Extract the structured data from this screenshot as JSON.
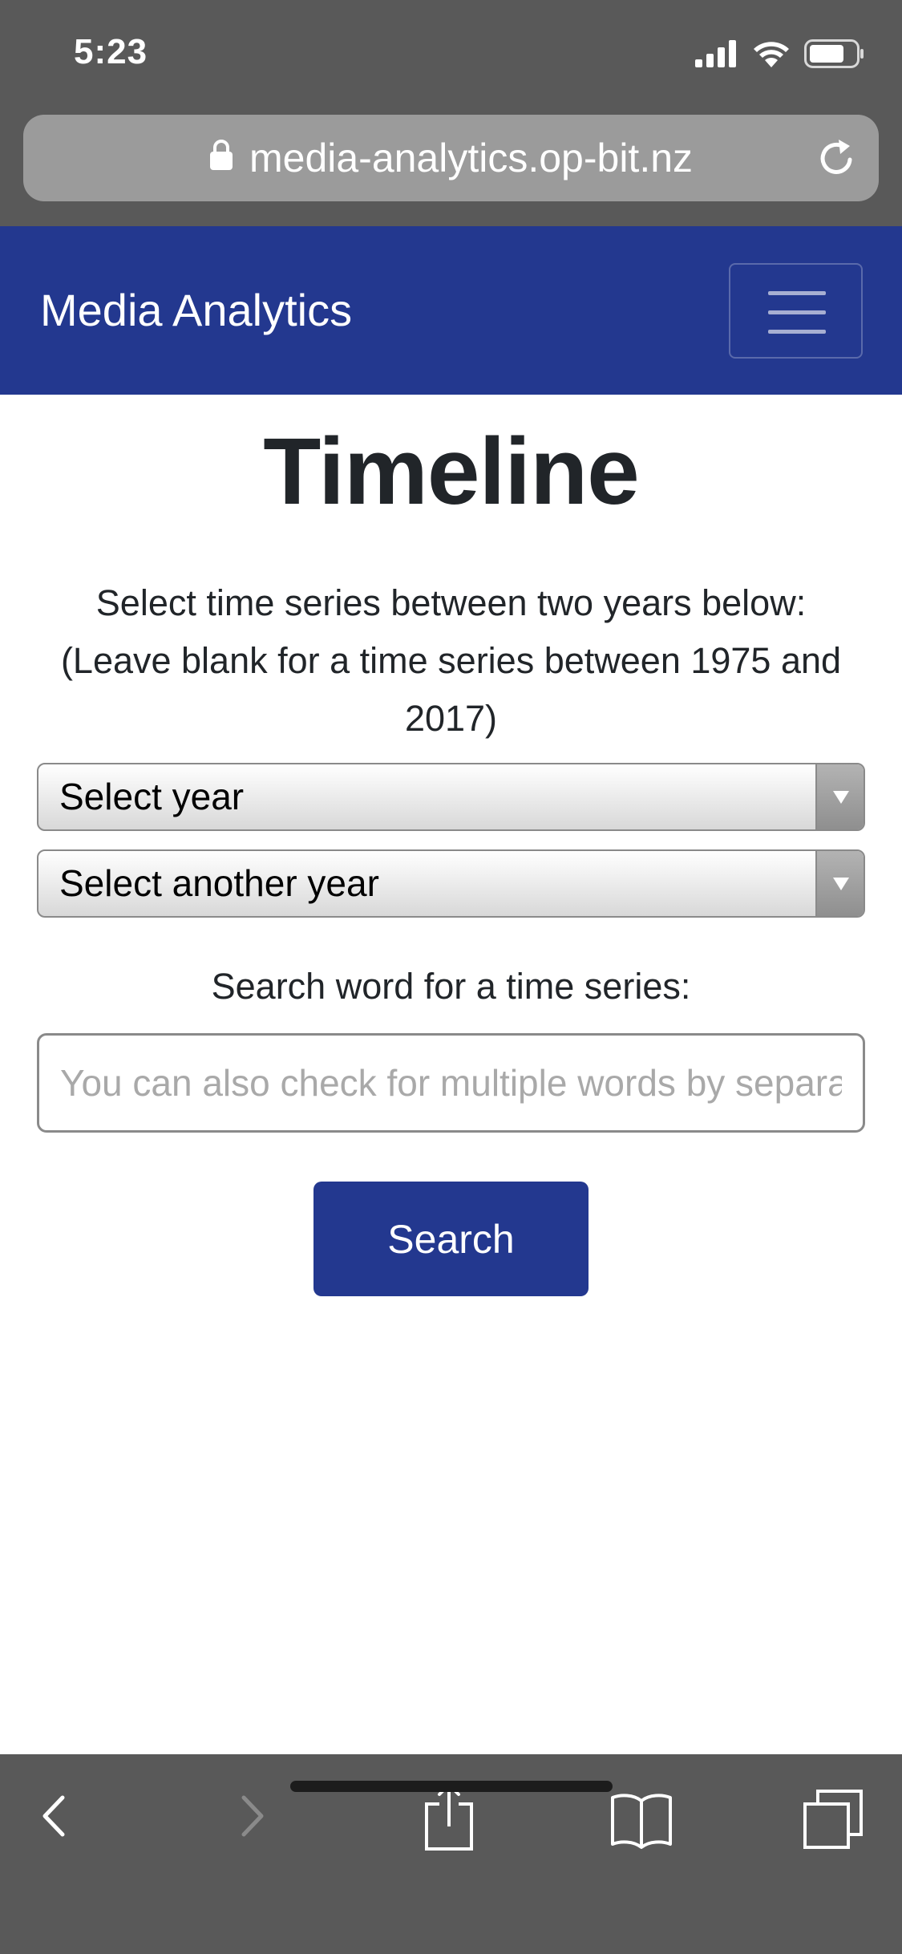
{
  "status_bar": {
    "time": "5:23",
    "icons": [
      "signal-icon",
      "wifi-icon",
      "battery-icon"
    ]
  },
  "browser": {
    "url": "media-analytics.op-bit.nz",
    "icons": [
      "lock-icon",
      "reload-icon"
    ],
    "toolbar_icons": [
      "back-icon",
      "forward-icon",
      "share-icon",
      "bookmarks-icon",
      "tabs-icon"
    ]
  },
  "navbar": {
    "brand": "Media Analytics",
    "toggler_icon": "hamburger-icon",
    "background_color": "#23388f"
  },
  "main": {
    "title": "Timeline",
    "instructions": "Select time series between two years below: (Leave blank for a time series between 1975 and 2017)",
    "select_start": {
      "value": "Select year"
    },
    "select_end": {
      "value": "Select another year"
    },
    "search_label": "Search word for a time series:",
    "search_input": {
      "value": "",
      "placeholder": "You can also check for multiple words by separating them with a comma"
    },
    "search_button": "Search",
    "accent_color": "#23388f"
  }
}
